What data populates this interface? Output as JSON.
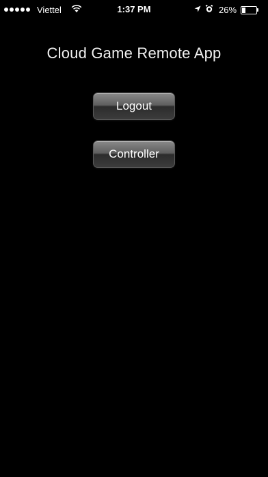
{
  "status_bar": {
    "carrier": "Viettel",
    "time": "1:37 PM",
    "battery_percent": "26%",
    "battery_level": 0.26,
    "signal_bars": 5,
    "icons": [
      "signal-dots-icon",
      "wifi-icon",
      "location-arrow-icon",
      "alarm-icon",
      "battery-icon"
    ]
  },
  "main": {
    "title": "Cloud Game Remote App",
    "logout_label": "Logout",
    "controller_label": "Controller"
  },
  "colors": {
    "background": "#000000",
    "text": "#ffffff"
  }
}
